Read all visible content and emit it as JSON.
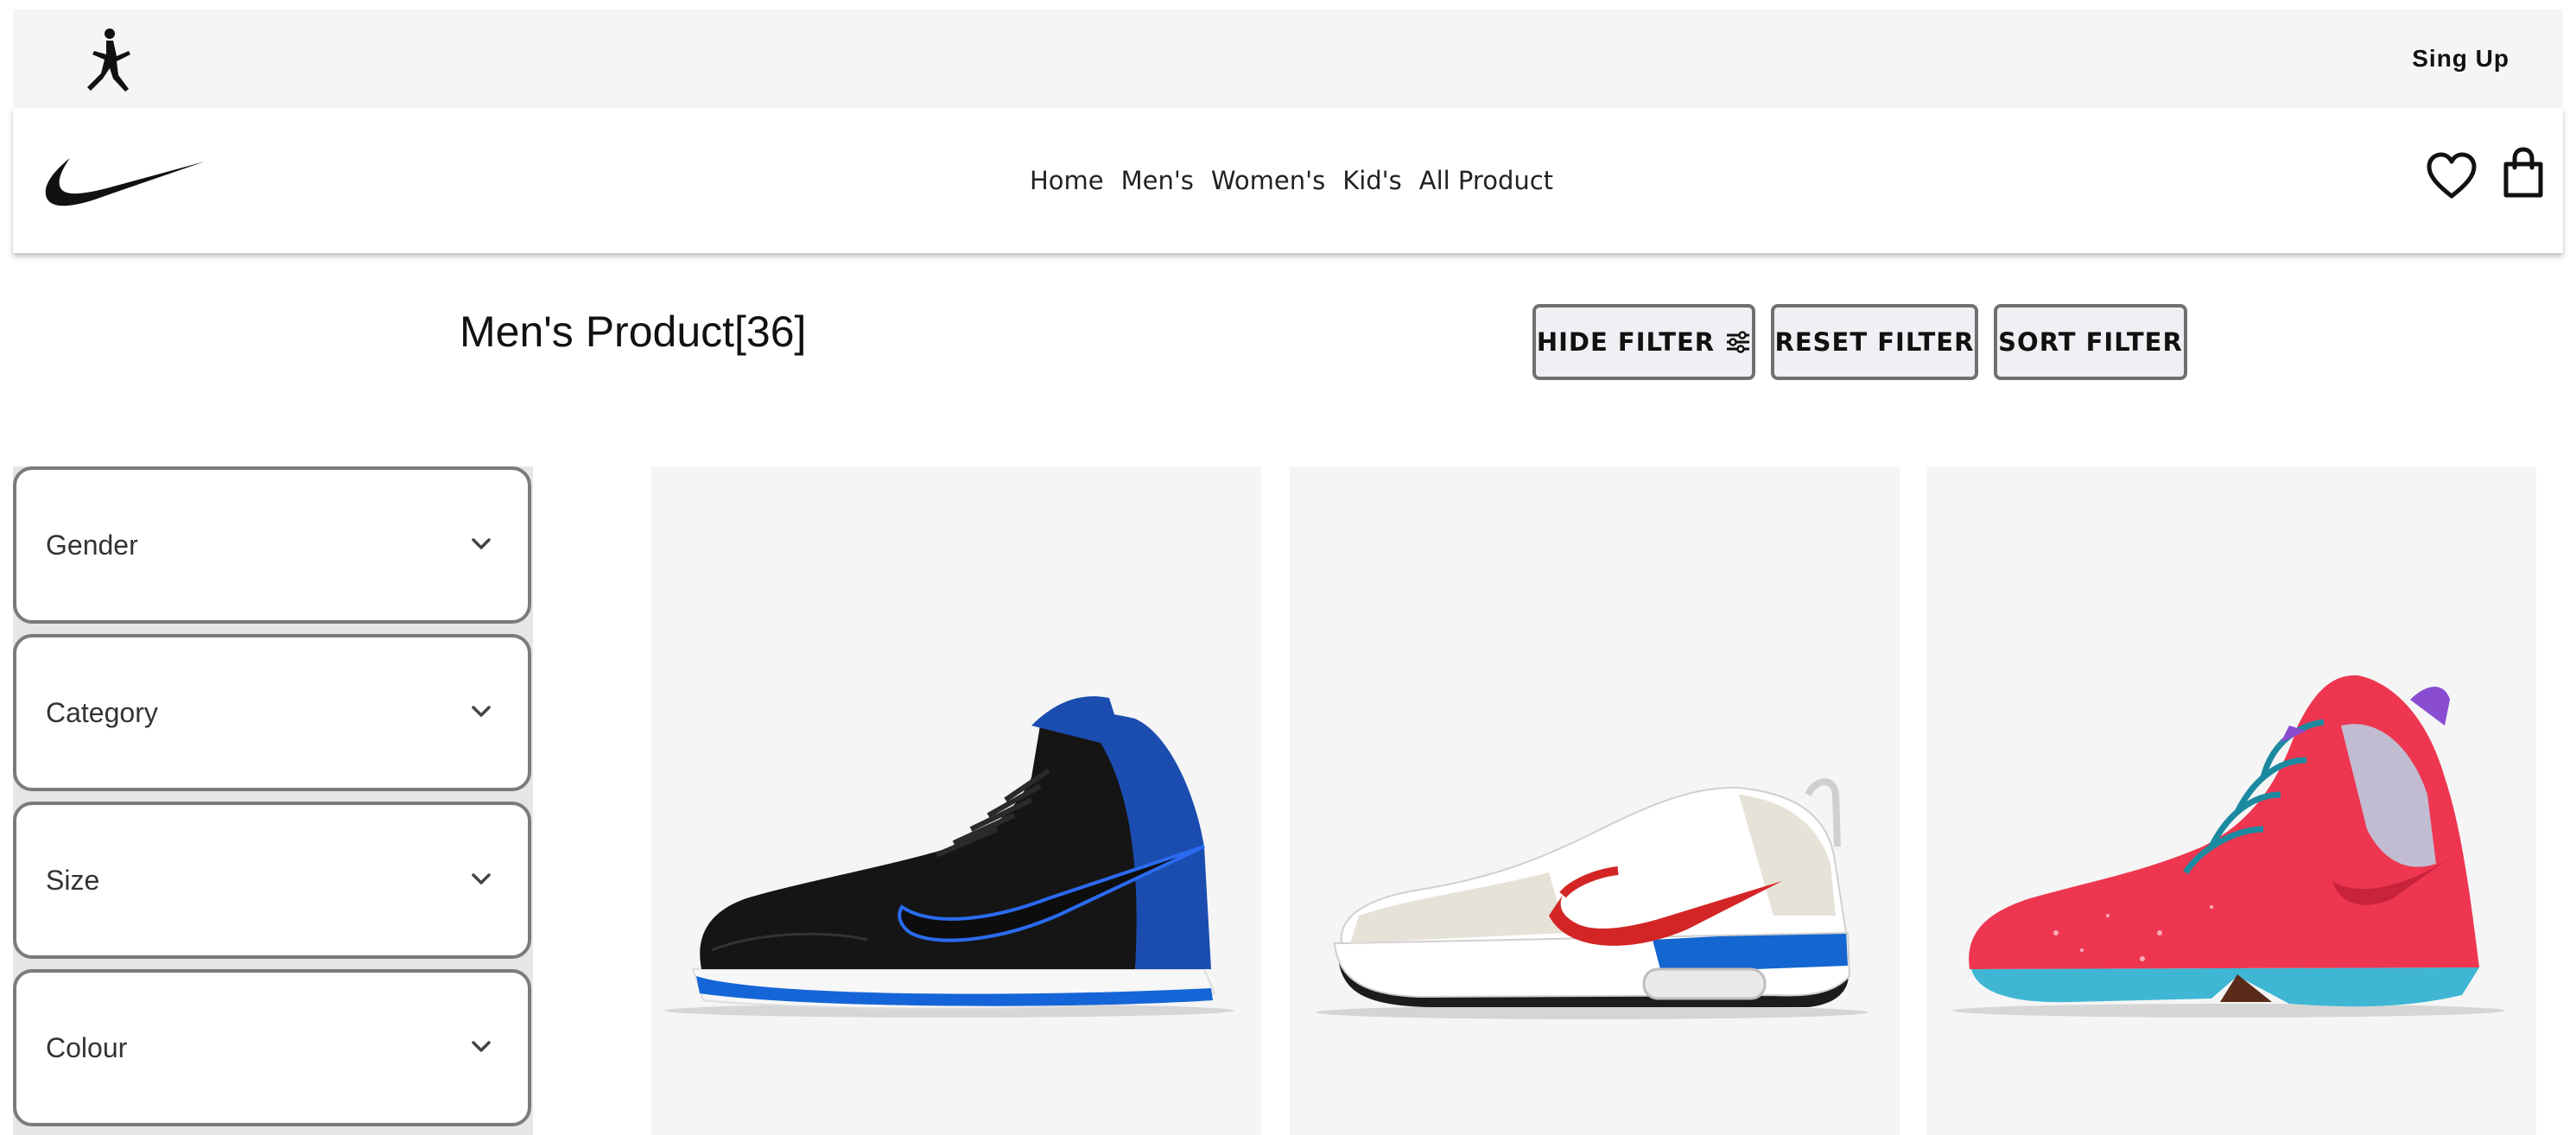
{
  "header": {
    "signup_label": "Sing Up",
    "jordan_logo": "jumpman-logo",
    "nike_logo": "swoosh-logo"
  },
  "nav": {
    "links": [
      "Home",
      "Men's",
      "Women's",
      "Kid's",
      "All Product"
    ]
  },
  "icons": {
    "wishlist": "heart-icon",
    "cart": "shopping-bag-icon",
    "filter": "sliders-icon",
    "dropdown": "chevron-down-icon"
  },
  "main": {
    "title": "Men's Product[36]",
    "buttons": {
      "hide_filter": "HIDE FILTER",
      "reset_filter": "RESET FILTER",
      "sort_filter": "SORT FILTER"
    }
  },
  "filters": [
    "Gender",
    "Category",
    "Size",
    "Colour"
  ],
  "products": [
    {
      "image": "high-top sneaker black and royal blue"
    },
    {
      "image": "running sneaker white with red swoosh"
    },
    {
      "image": "basketball sneaker red with teal accents"
    }
  ],
  "colors": {
    "topbar_bg": "#f5f5f5",
    "card_bg": "#f5f5f5",
    "button_bg": "#eef0f3",
    "border": "#707070"
  }
}
